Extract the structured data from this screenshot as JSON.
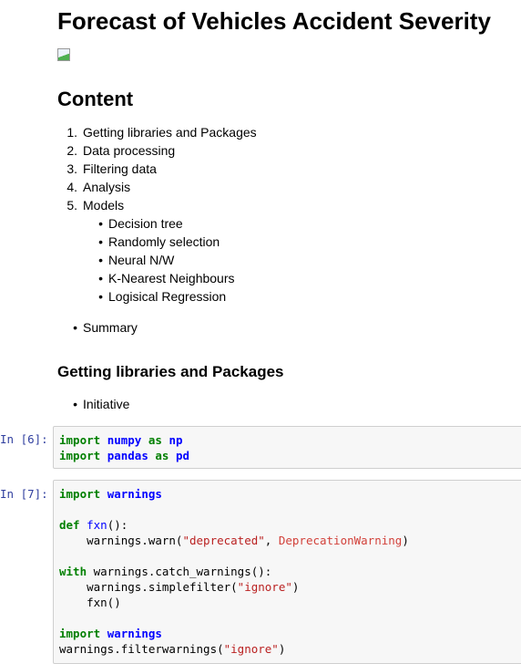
{
  "title": "Forecast of Vehicles Accident Severity",
  "content_heading": "Content",
  "content_list": [
    {
      "marker": "1.",
      "label": "Getting libraries and Packages"
    },
    {
      "marker": "2.",
      "label": "Data processing"
    },
    {
      "marker": "3.",
      "label": "Filtering data"
    },
    {
      "marker": "4.",
      "label": "Analysis"
    },
    {
      "marker": "5.",
      "label": "Models"
    }
  ],
  "models": [
    "Decision tree",
    "Randomly selection",
    "Neural N/W",
    "K-Nearest Neighbours",
    "Logisical Regression"
  ],
  "summary": "Summary",
  "section_heading": "Getting libraries and Packages",
  "section_items": [
    "Initiative"
  ],
  "cells": [
    {
      "prompt": "In [6]:",
      "lines": [
        [
          [
            "kw",
            "import"
          ],
          [
            "tx",
            " "
          ],
          [
            "nm",
            "numpy"
          ],
          [
            "tx",
            " "
          ],
          [
            "kw",
            "as"
          ],
          [
            "tx",
            " "
          ],
          [
            "nm",
            "np"
          ]
        ],
        [
          [
            "kw",
            "import"
          ],
          [
            "tx",
            " "
          ],
          [
            "nm",
            "pandas"
          ],
          [
            "tx",
            " "
          ],
          [
            "kw",
            "as"
          ],
          [
            "tx",
            " "
          ],
          [
            "nm",
            "pd"
          ]
        ]
      ]
    },
    {
      "prompt": "In [7]:",
      "lines": [
        [
          [
            "kw",
            "import"
          ],
          [
            "tx",
            " "
          ],
          [
            "nm",
            "warnings"
          ]
        ],
        [],
        [
          [
            "kw",
            "def"
          ],
          [
            "tx",
            " "
          ],
          [
            "fn",
            "fxn"
          ],
          [
            "tx",
            "():"
          ]
        ],
        [
          [
            "tx",
            "    warnings.warn("
          ],
          [
            "st",
            "\"deprecated\""
          ],
          [
            "tx",
            ", "
          ],
          [
            "ex",
            "DeprecationWarning"
          ],
          [
            "tx",
            ")"
          ]
        ],
        [],
        [
          [
            "kw",
            "with"
          ],
          [
            "tx",
            " warnings.catch_warnings():"
          ]
        ],
        [
          [
            "tx",
            "    warnings.simplefilter("
          ],
          [
            "st",
            "\"ignore\""
          ],
          [
            "tx",
            ")"
          ]
        ],
        [
          [
            "tx",
            "    fxn()"
          ]
        ],
        [],
        [
          [
            "kw",
            "import"
          ],
          [
            "tx",
            " "
          ],
          [
            "nm",
            "warnings"
          ]
        ],
        [
          [
            "tx",
            "warnings.filterwarnings("
          ],
          [
            "st",
            "\"ignore\""
          ],
          [
            "tx",
            ")"
          ]
        ]
      ]
    }
  ]
}
